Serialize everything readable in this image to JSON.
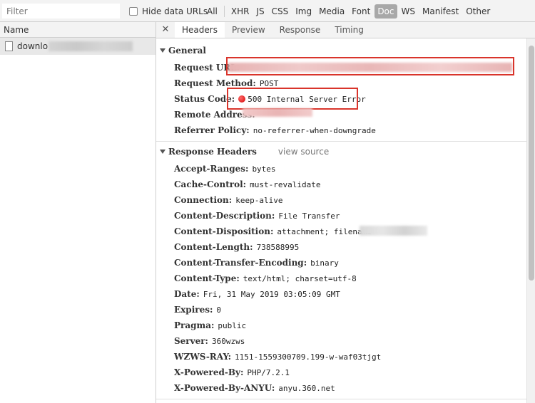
{
  "filter": {
    "placeholder": "Filter"
  },
  "hide_data_urls": {
    "label": "Hide data URLs",
    "checked": false
  },
  "filter_types": [
    {
      "label": "All",
      "active": false
    },
    {
      "label": "XHR",
      "active": false
    },
    {
      "label": "JS",
      "active": false
    },
    {
      "label": "CSS",
      "active": false
    },
    {
      "label": "Img",
      "active": false
    },
    {
      "label": "Media",
      "active": false
    },
    {
      "label": "Font",
      "active": false
    },
    {
      "label": "Doc",
      "active": true
    },
    {
      "label": "WS",
      "active": false
    },
    {
      "label": "Manifest",
      "active": false
    },
    {
      "label": "Other",
      "active": false
    }
  ],
  "list": {
    "column_header": "Name",
    "requests": [
      {
        "name": "downlo",
        "icon": "file-icon"
      }
    ]
  },
  "tabs": {
    "close_icon": "close-icon",
    "items": [
      "Headers",
      "Preview",
      "Response",
      "Timing"
    ],
    "active": "Headers"
  },
  "general": {
    "title": "General",
    "request_url_label": "Request URL:",
    "request_method_label": "Request Method:",
    "request_method": "POST",
    "status_code_label": "Status Code:",
    "status_code": "500 Internal Server Error",
    "status_color": "#d40000",
    "remote_address_label": "Remote Address:",
    "referrer_policy_label": "Referrer Policy:",
    "referrer_policy": "no-referrer-when-downgrade"
  },
  "response_headers": {
    "title": "Response Headers",
    "view_source": "view source",
    "items": [
      {
        "key": "Accept-Ranges:",
        "value": "bytes"
      },
      {
        "key": "Cache-Control:",
        "value": "must-revalidate"
      },
      {
        "key": "Connection:",
        "value": "keep-alive"
      },
      {
        "key": "Content-Description:",
        "value": "File Transfer"
      },
      {
        "key": "Content-Disposition:",
        "value": "attachment; filename="
      },
      {
        "key": "Content-Length:",
        "value": "738588995"
      },
      {
        "key": "Content-Transfer-Encoding:",
        "value": "binary"
      },
      {
        "key": "Content-Type:",
        "value": "text/html; charset=utf-8"
      },
      {
        "key": "Date:",
        "value": "Fri, 31 May 2019 03:05:09 GMT"
      },
      {
        "key": "Expires:",
        "value": "0"
      },
      {
        "key": "Pragma:",
        "value": "public"
      },
      {
        "key": "Server:",
        "value": "360wzws"
      },
      {
        "key": "WZWS-RAY:",
        "value": "1151-1559300709.199-w-waf03tjgt"
      },
      {
        "key": "X-Powered-By:",
        "value": "PHP/7.2.1"
      },
      {
        "key": "X-Powered-By-ANYU:",
        "value": "anyu.360.net"
      }
    ]
  },
  "highlight_color": "#d9342b"
}
